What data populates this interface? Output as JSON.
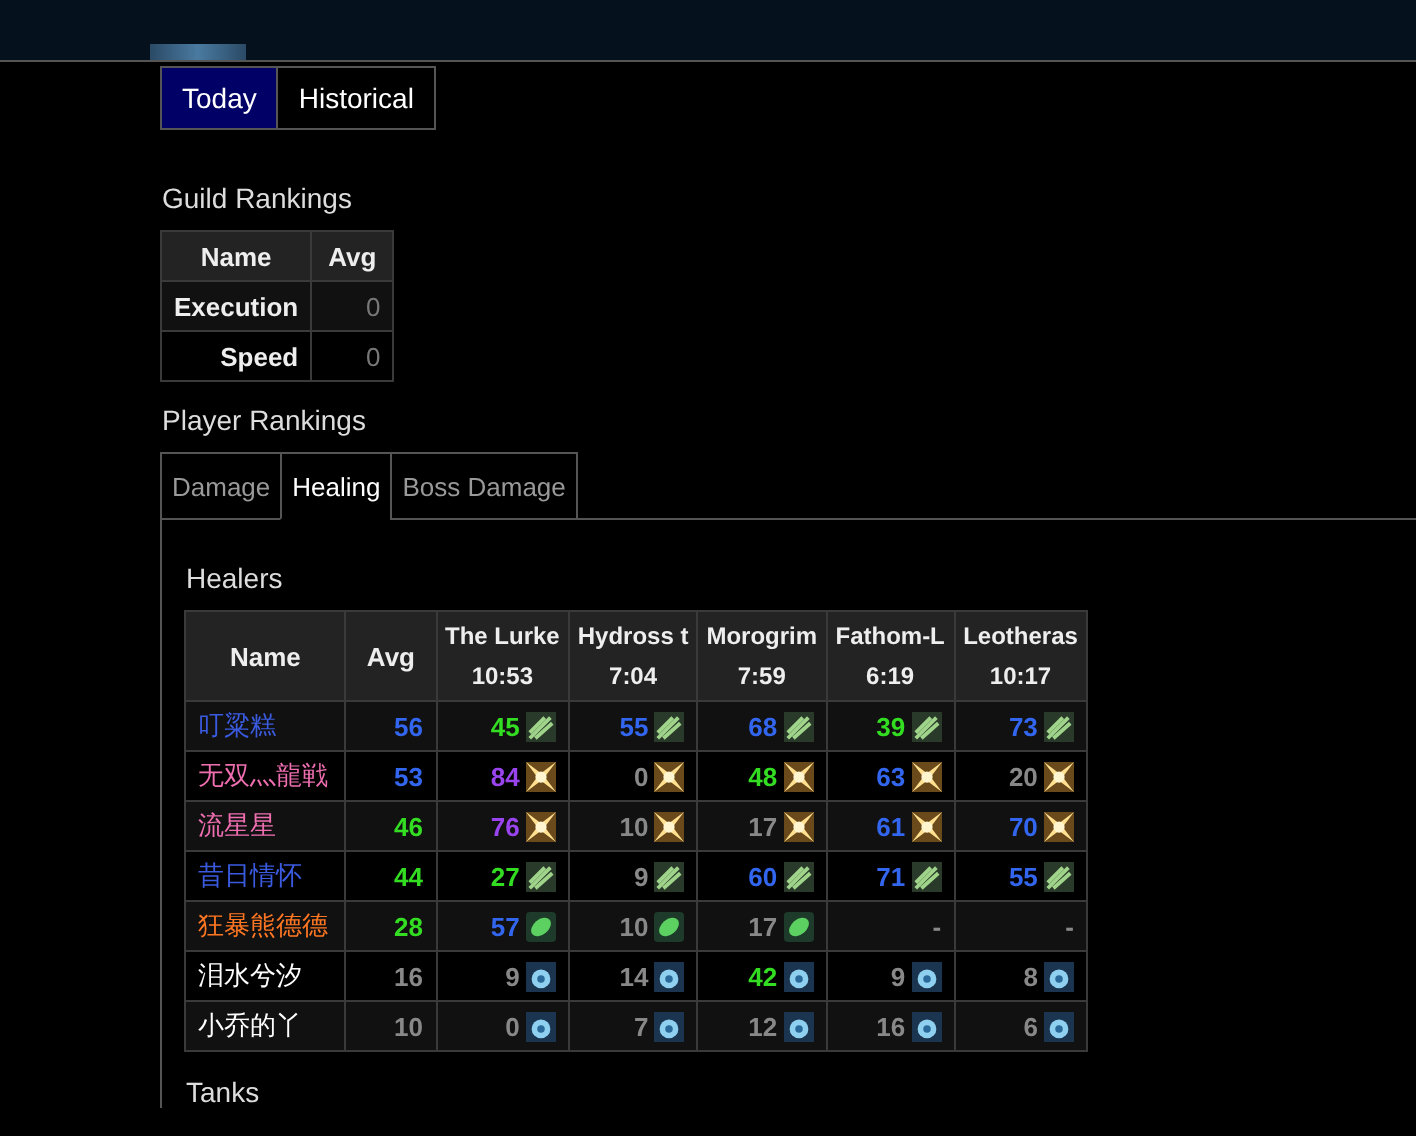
{
  "view_tabs": [
    {
      "label": "Today",
      "selected": true
    },
    {
      "label": "Historical",
      "selected": false
    }
  ],
  "guild_rankings": {
    "title": "Guild Rankings",
    "columns": [
      "Name",
      "Avg"
    ],
    "rows": [
      {
        "name": "Execution",
        "avg": "0"
      },
      {
        "name": "Speed",
        "avg": "0"
      }
    ]
  },
  "player_rankings": {
    "title": "Player Rankings",
    "tabs": [
      {
        "label": "Damage",
        "selected": false
      },
      {
        "label": "Healing",
        "selected": true
      },
      {
        "label": "Boss Damage",
        "selected": false
      }
    ],
    "section_title": "Healers",
    "columns": [
      {
        "name": "Name"
      },
      {
        "name": "Avg"
      },
      {
        "name": "The Lurke",
        "time": "10:53"
      },
      {
        "name": "Hydross t",
        "time": "7:04"
      },
      {
        "name": "Morogrim",
        "time": "7:59"
      },
      {
        "name": "Fathom-L",
        "time": "6:19"
      },
      {
        "name": "Leotheras",
        "time": "10:17"
      }
    ],
    "rows": [
      {
        "name": "叮粱糕",
        "color": "#3a5be0",
        "kind": "streak",
        "avg": {
          "score": "56",
          "color": "#3366ee"
        },
        "scores": [
          {
            "score": "45",
            "color": "#33dd22",
            "icon": true
          },
          {
            "score": "55",
            "color": "#3366ee",
            "icon": true
          },
          {
            "score": "68",
            "color": "#3366ee",
            "icon": true
          },
          {
            "score": "39",
            "color": "#33dd22",
            "icon": true
          },
          {
            "score": "73",
            "color": "#3366ee",
            "icon": true
          }
        ]
      },
      {
        "name": "无双灬龍戦",
        "color": "#ee6eb0",
        "kind": "holy",
        "avg": {
          "score": "53",
          "color": "#3366ee"
        },
        "scores": [
          {
            "score": "84",
            "color": "#9944ee",
            "icon": true
          },
          {
            "score": "0",
            "color": "#888888",
            "icon": true
          },
          {
            "score": "48",
            "color": "#33dd22",
            "icon": true
          },
          {
            "score": "63",
            "color": "#3366ee",
            "icon": true
          },
          {
            "score": "20",
            "color": "#888888",
            "icon": true
          }
        ]
      },
      {
        "name": "流星星",
        "color": "#ee6eb0",
        "kind": "holy",
        "avg": {
          "score": "46",
          "color": "#33dd22"
        },
        "scores": [
          {
            "score": "76",
            "color": "#9944ee",
            "icon": true
          },
          {
            "score": "10",
            "color": "#888888",
            "icon": true
          },
          {
            "score": "17",
            "color": "#888888",
            "icon": true
          },
          {
            "score": "61",
            "color": "#3366ee",
            "icon": true
          },
          {
            "score": "70",
            "color": "#3366ee",
            "icon": true
          }
        ]
      },
      {
        "name": "昔日情怀",
        "color": "#3a5be0",
        "kind": "streak",
        "avg": {
          "score": "44",
          "color": "#33dd22"
        },
        "scores": [
          {
            "score": "27",
            "color": "#33dd22",
            "icon": true
          },
          {
            "score": "9",
            "color": "#888888",
            "icon": true
          },
          {
            "score": "60",
            "color": "#3366ee",
            "icon": true
          },
          {
            "score": "71",
            "color": "#3366ee",
            "icon": true
          },
          {
            "score": "55",
            "color": "#3366ee",
            "icon": true
          }
        ]
      },
      {
        "name": "狂暴熊德德",
        "color": "#ff7722",
        "kind": "leaf",
        "avg": {
          "score": "28",
          "color": "#33dd22"
        },
        "scores": [
          {
            "score": "57",
            "color": "#3366ee",
            "icon": true
          },
          {
            "score": "10",
            "color": "#888888",
            "icon": true
          },
          {
            "score": "17",
            "color": "#888888",
            "icon": true
          },
          {
            "score": "-",
            "color": "#888888",
            "icon": false
          },
          {
            "score": "-",
            "color": "#888888",
            "icon": false
          }
        ]
      },
      {
        "name": "泪水兮汐",
        "color": "#ffffff",
        "kind": "water",
        "avg": {
          "score": "16",
          "color": "#888888"
        },
        "scores": [
          {
            "score": "9",
            "color": "#888888",
            "icon": true
          },
          {
            "score": "14",
            "color": "#888888",
            "icon": true
          },
          {
            "score": "42",
            "color": "#33dd22",
            "icon": true
          },
          {
            "score": "9",
            "color": "#888888",
            "icon": true
          },
          {
            "score": "8",
            "color": "#888888",
            "icon": true
          }
        ]
      },
      {
        "name": "小乔的丫",
        "color": "#ffffff",
        "kind": "water",
        "avg": {
          "score": "10",
          "color": "#888888"
        },
        "scores": [
          {
            "score": "0",
            "color": "#888888",
            "icon": true
          },
          {
            "score": "7",
            "color": "#888888",
            "icon": true
          },
          {
            "score": "12",
            "color": "#888888",
            "icon": true
          },
          {
            "score": "16",
            "color": "#888888",
            "icon": true
          },
          {
            "score": "6",
            "color": "#888888",
            "icon": true
          }
        ]
      }
    ],
    "next_section_title": "Tanks"
  }
}
